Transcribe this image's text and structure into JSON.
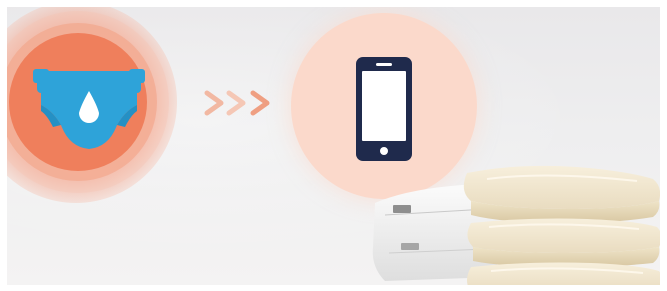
{
  "scene": {
    "icons": {
      "diaper": "diaper-drop-icon",
      "arrows": "triple-chevron-right-icon",
      "phone": "smartphone-icon",
      "pads": "folded-pads-stack"
    },
    "colors": {
      "accent_orange": "#ef7f5c",
      "diaper_blue": "#2ea3d9",
      "arrow_salmon": "#f2a58a",
      "phone_bg": "#fbd9cb",
      "phone_navy": "#1f2a4c",
      "background": "#eeeeef"
    }
  }
}
